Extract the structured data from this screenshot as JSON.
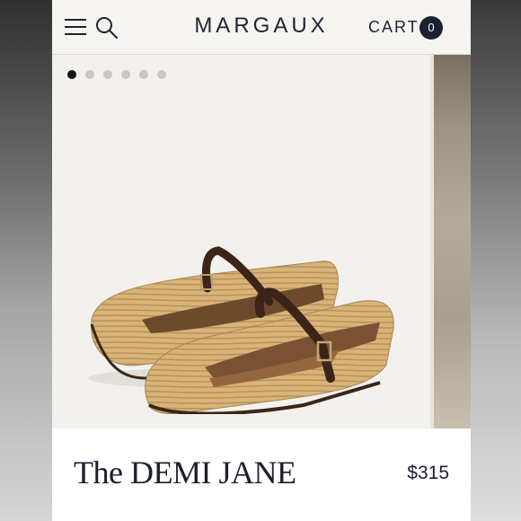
{
  "header": {
    "brand": "MARGAUX",
    "cart_label": "CART",
    "cart_count": "0",
    "menu_icon": "hamburger-menu-icon",
    "search_icon": "search-icon"
  },
  "gallery": {
    "image_count": 6,
    "active_index": 0,
    "image_subject": "raffia mary jane flats with brown leather straps"
  },
  "product": {
    "name": "The DEMI JANE",
    "price": "$315"
  },
  "colors": {
    "brand_navy": "#1c2033",
    "header_bg": "#f6f4f1",
    "gallery_bg": "#f3f1ee"
  }
}
